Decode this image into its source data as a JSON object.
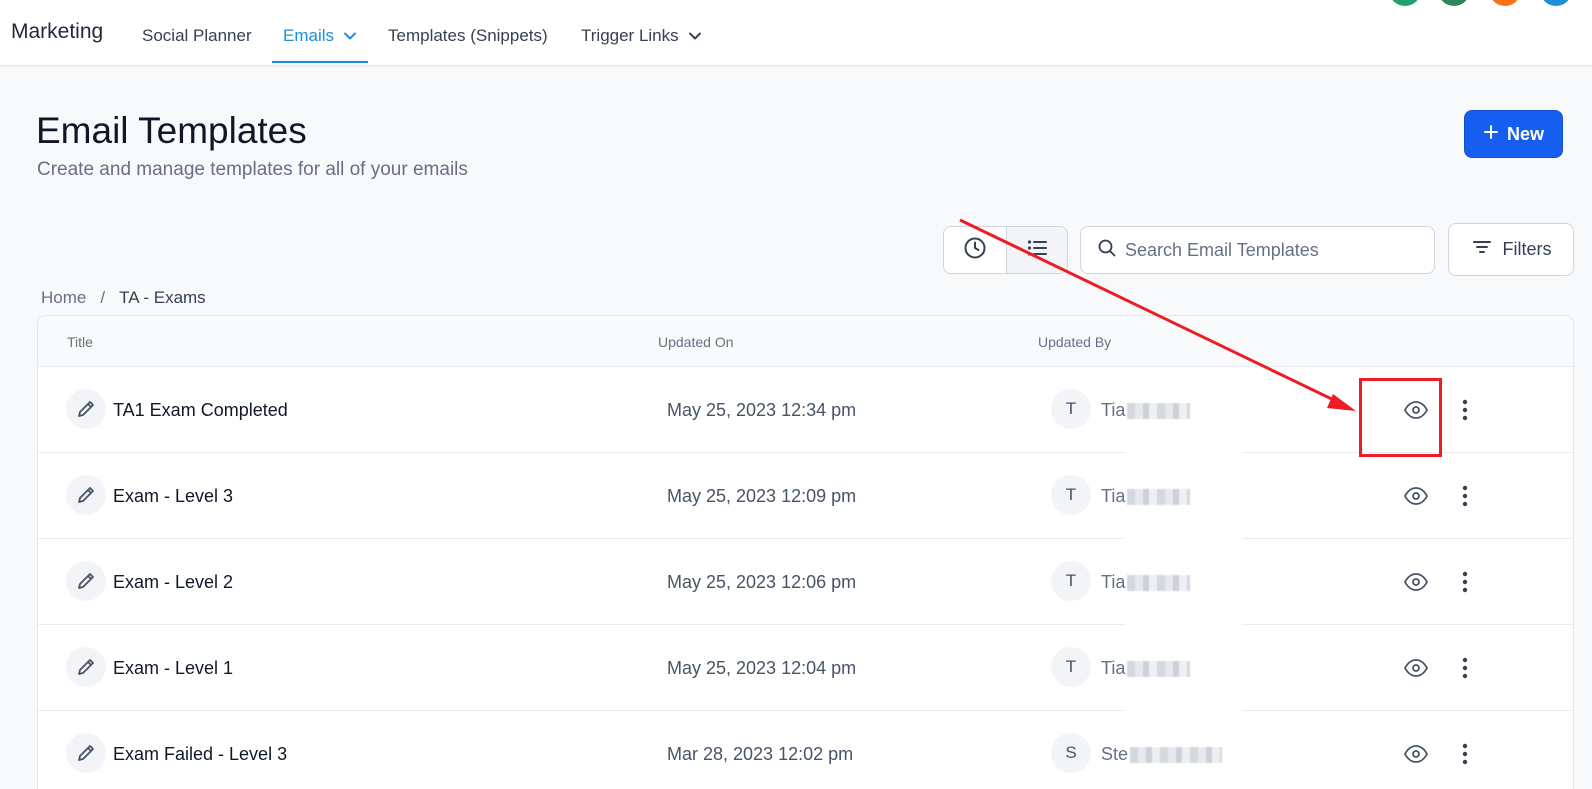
{
  "nav": {
    "brand": "Marketing",
    "items": [
      {
        "label": "Social Planner"
      },
      {
        "label": "Emails",
        "active": true
      },
      {
        "label": "Templates (Snippets)"
      },
      {
        "label": "Trigger Links"
      }
    ]
  },
  "header": {
    "title": "Email Templates",
    "subtitle": "Create and manage templates for all of your emails",
    "new_label": "New"
  },
  "toolbar": {
    "search_placeholder": "Search Email Templates",
    "search_value": "",
    "filters_label": "Filters",
    "view_mode": "list"
  },
  "breadcrumb": {
    "home": "Home",
    "separator": "/",
    "current": "TA - Exams"
  },
  "table": {
    "columns": [
      "Title",
      "Updated On",
      "Updated By"
    ],
    "rows": [
      {
        "title": "TA1 Exam Completed",
        "updated_on": "May 25, 2023 12:34 pm",
        "avatar": "T",
        "user": "Tia"
      },
      {
        "title": "Exam - Level 3",
        "updated_on": "May 25, 2023 12:09 pm",
        "avatar": "T",
        "user": "Tia"
      },
      {
        "title": "Exam - Level 2",
        "updated_on": "May 25, 2023 12:06 pm",
        "avatar": "T",
        "user": "Tia"
      },
      {
        "title": "Exam - Level 1",
        "updated_on": "May 25, 2023 12:04 pm",
        "avatar": "T",
        "user": "Tia"
      },
      {
        "title": "Exam Failed - Level 3",
        "updated_on": "Mar 28, 2023 12:02 pm",
        "avatar": "S",
        "user": "Ste"
      }
    ]
  },
  "icons": {
    "edit": "pencil-icon",
    "preview": "eye-icon",
    "more": "more-vertical-icon",
    "history": "clock-icon",
    "list": "list-icon",
    "search": "search-icon",
    "filter": "filter-icon",
    "new": "plus-icon"
  },
  "colors": {
    "primary": "#155eef",
    "nav_active": "#1d8fd8",
    "annotation": "#ee1c24",
    "avatar_dots": [
      "#22a06b",
      "#2f855a",
      "#f97316",
      "#1d8fd8"
    ]
  }
}
